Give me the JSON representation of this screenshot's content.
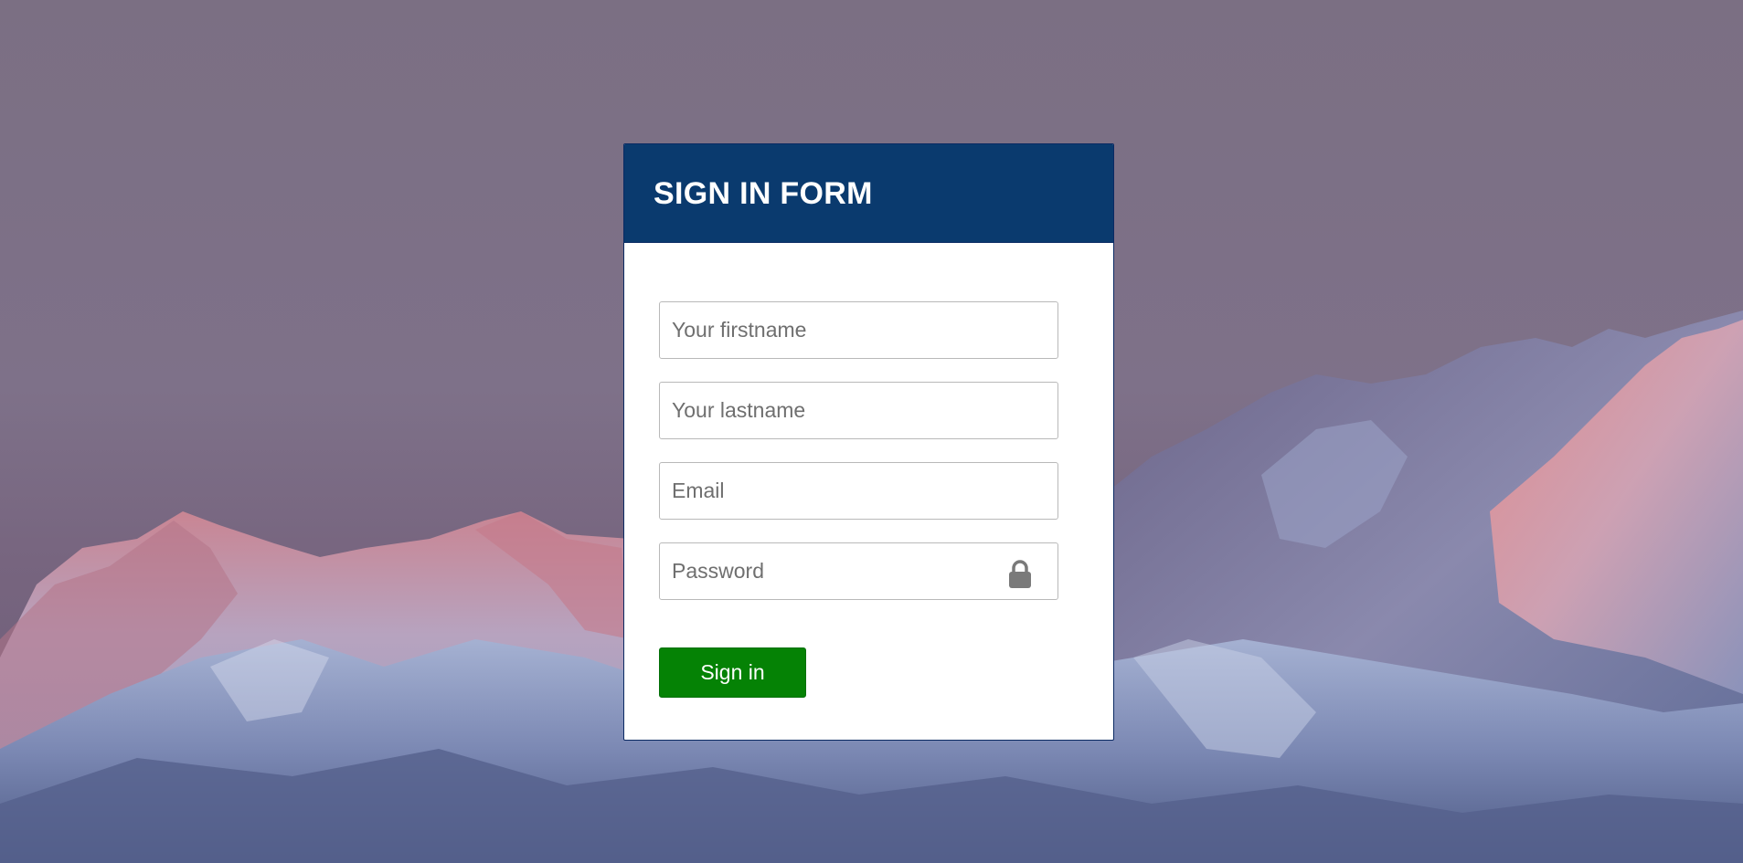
{
  "form": {
    "title": "SIGN IN FORM",
    "fields": [
      {
        "placeholder": "Your firstname",
        "value": "",
        "type": "text"
      },
      {
        "placeholder": "Your lastname",
        "value": "",
        "type": "text"
      },
      {
        "placeholder": "Email",
        "value": "",
        "type": "email"
      },
      {
        "placeholder": "Password",
        "value": "",
        "type": "password",
        "icon": "lock-icon"
      }
    ],
    "submit_label": "Sign in"
  },
  "colors": {
    "header": "#0a3a6e",
    "button": "#058205",
    "sky": "#7d7286"
  },
  "background": {
    "subject": "snow-capped mountain range at sunset"
  }
}
